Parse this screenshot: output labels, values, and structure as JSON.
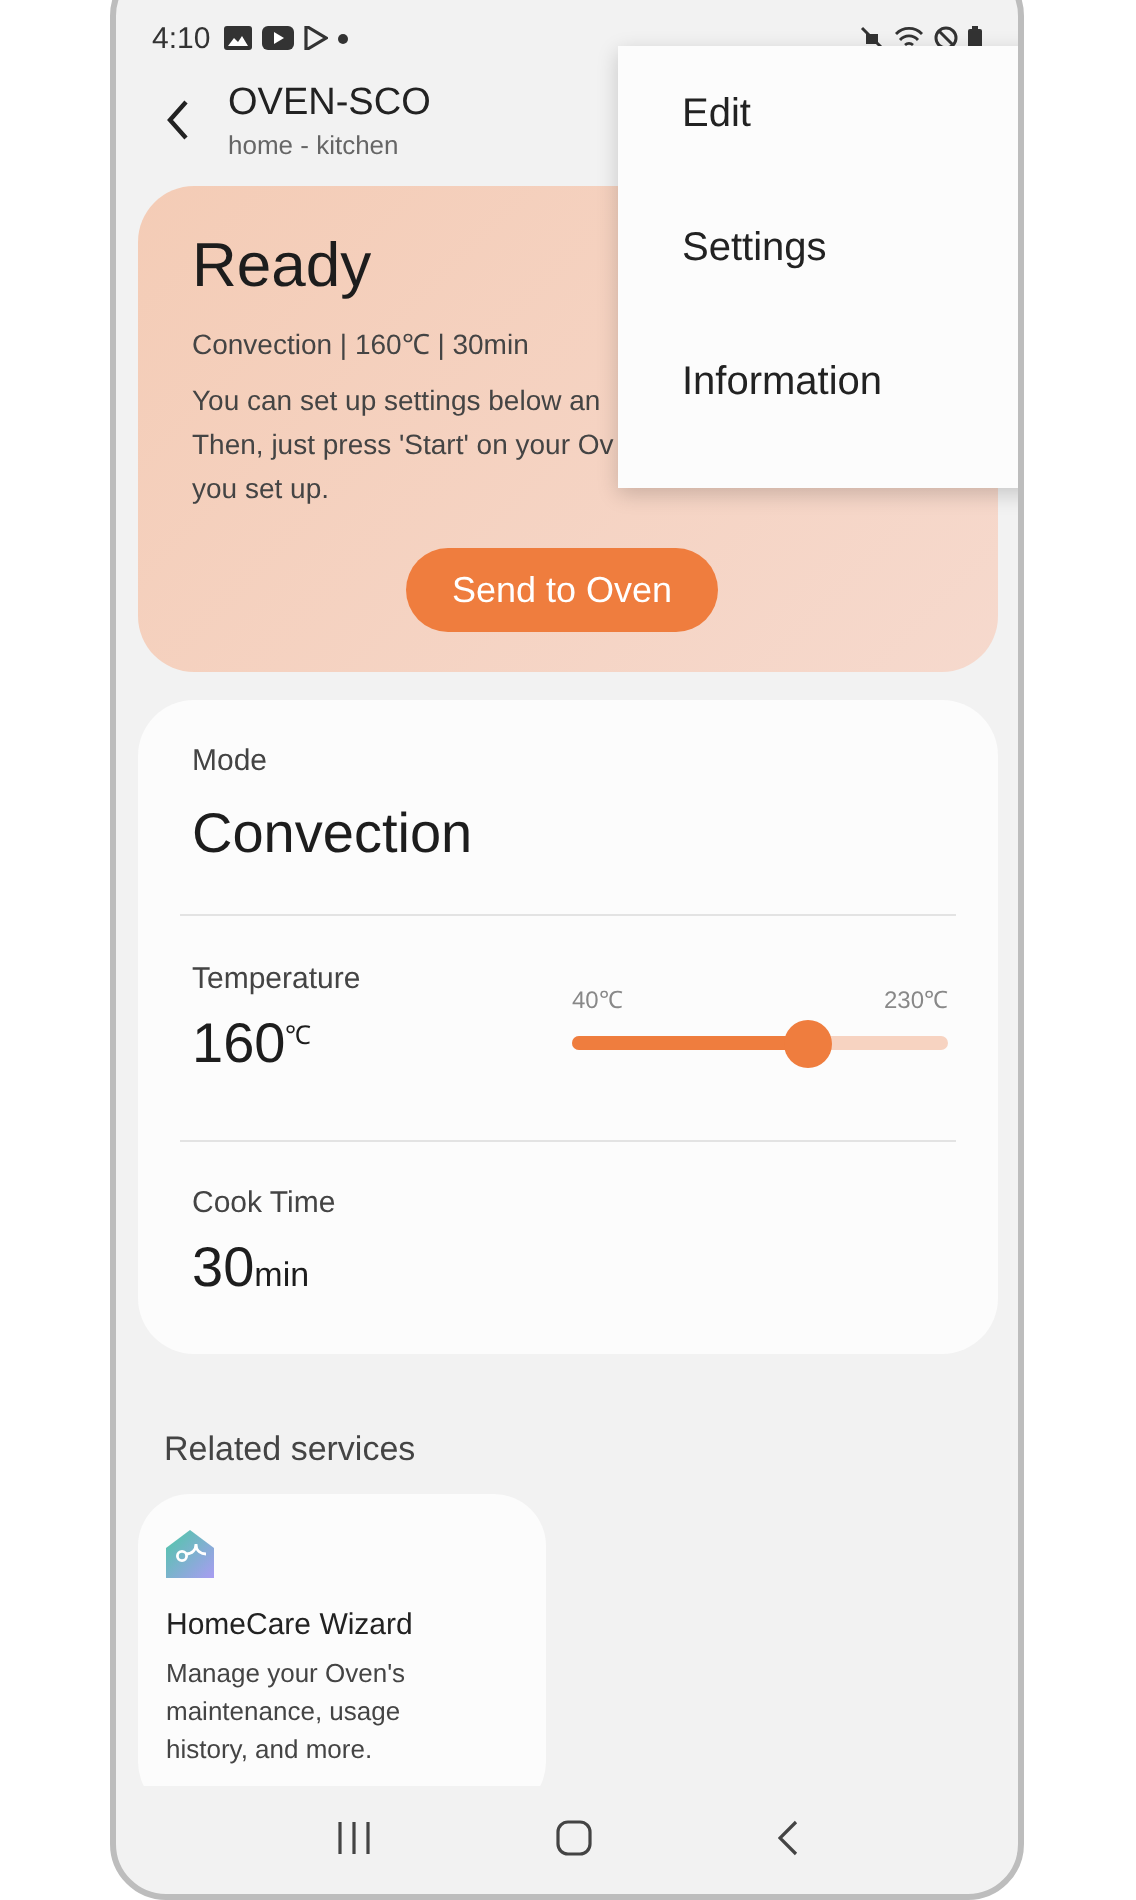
{
  "status_bar": {
    "time": "4:10"
  },
  "header": {
    "title": "OVEN-SCO",
    "subtitle": "home - kitchen"
  },
  "menu": {
    "items": [
      {
        "label": "Edit"
      },
      {
        "label": "Settings"
      },
      {
        "label": "Information"
      }
    ]
  },
  "status_card": {
    "title": "Ready",
    "summary": "Convection | 160℃ | 30min",
    "lines": [
      "You can set up settings below an",
      "Then, just press 'Start' on your Ov",
      "you set up."
    ],
    "button": "Send to Oven"
  },
  "mode": {
    "label": "Mode",
    "value": "Convection"
  },
  "temperature": {
    "label": "Temperature",
    "value": "160",
    "unit": "℃",
    "min": "40℃",
    "max": "230℃",
    "level": 0.63
  },
  "cook_time": {
    "label": "Cook Time",
    "value": "30",
    "unit": "min"
  },
  "related": {
    "title": "Related services",
    "services": [
      {
        "name": "HomeCare Wizard",
        "description": "Manage your Oven's maintenance, usage history, and more."
      }
    ]
  }
}
